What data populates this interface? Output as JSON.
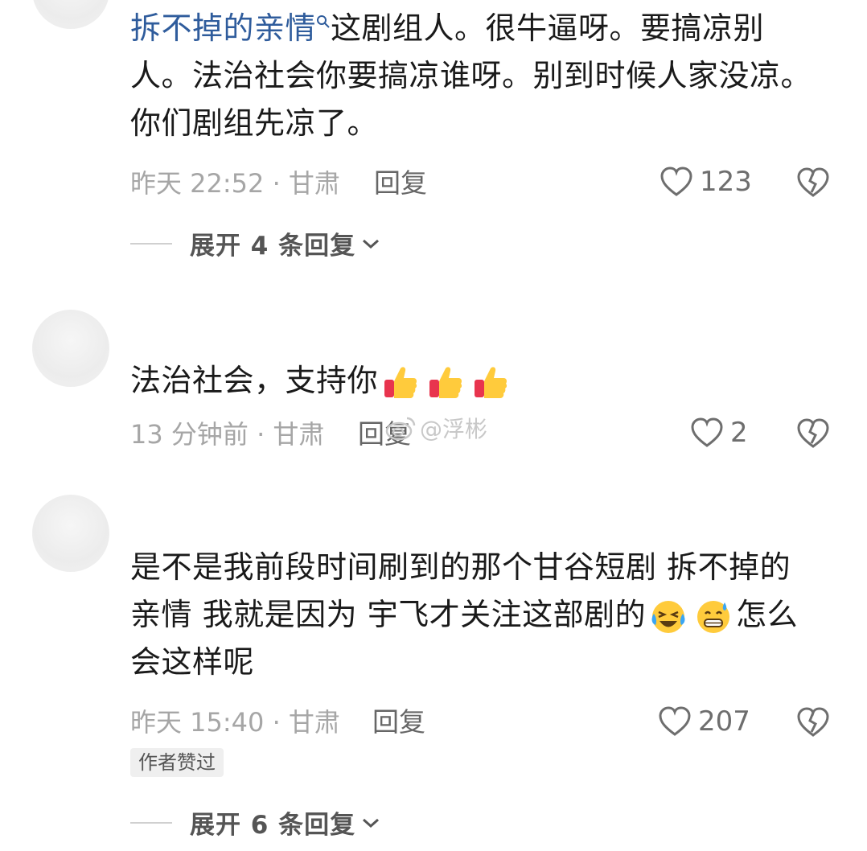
{
  "comments": [
    {
      "topic": "拆不掉的亲情",
      "line1": "这剧组人。很牛逼呀。要搞凉别",
      "line2": "人。法治社会你要搞凉谁呀。别到时候人家没凉。",
      "line3": "你们剧组先凉了。",
      "meta": "昨天 22:52 · 甘肃",
      "reply_label": "回复",
      "like_count": "123",
      "expand_label": "展开 4 条回复"
    },
    {
      "line1": "法治社会，支持你",
      "meta": "13 分钟前 · 甘肃",
      "reply_label": "回复",
      "like_count": "2"
    },
    {
      "line1": "是不是我前段时间刷到的那个甘谷短剧 拆不掉的",
      "line2": "亲情 我就是因为 宇飞才关注这部剧的",
      "line2b": "怎么",
      "line3": "会这样呢",
      "meta": "昨天 15:40 · 甘肃",
      "reply_label": "回复",
      "like_count": "207",
      "author_badge": "作者赞过",
      "expand_label": "展开 6 条回复"
    }
  ],
  "watermark": "@浮彬",
  "icons": [
    "search-icon",
    "heart-icon",
    "broken-heart-icon",
    "chevron-down-icon",
    "thumbs-up-emoji",
    "laughing-crying-emoji",
    "grin-sweat-emoji",
    "weibo-logo"
  ]
}
